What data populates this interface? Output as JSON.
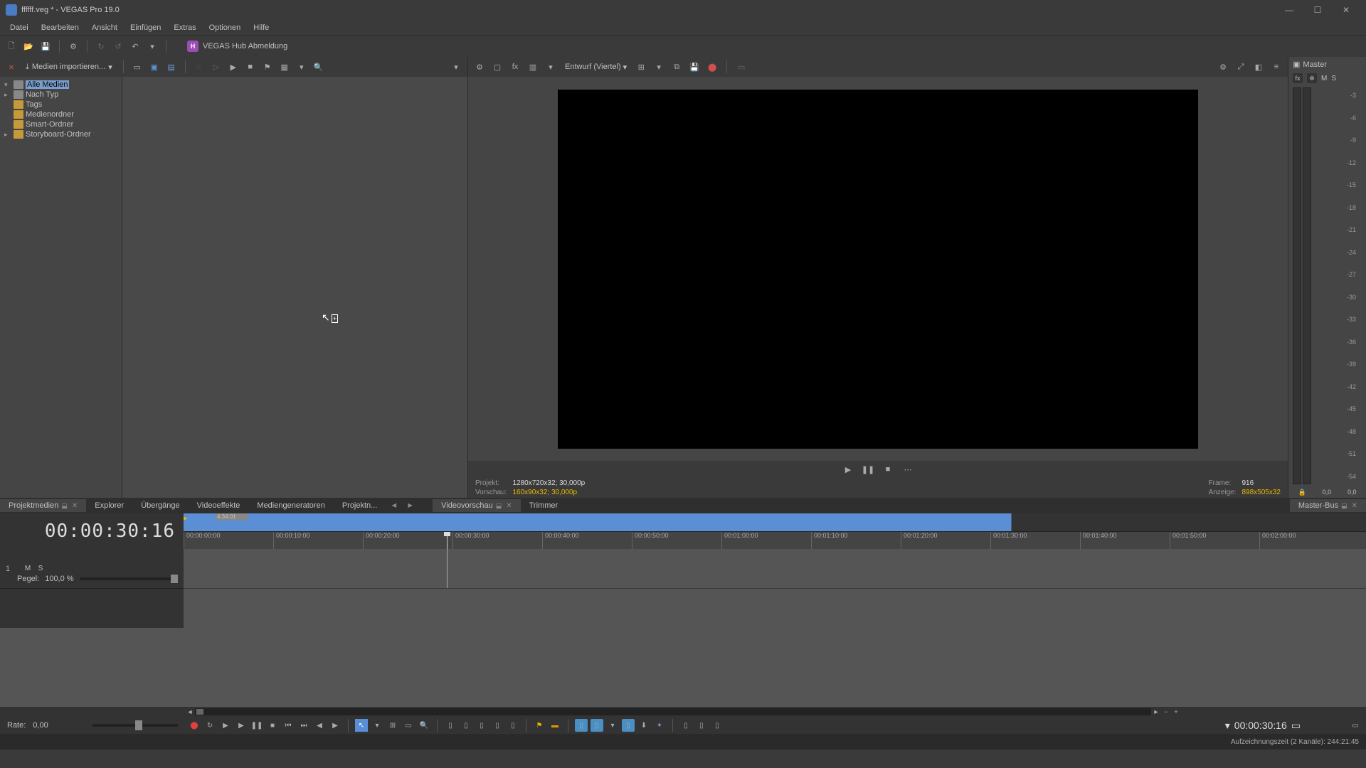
{
  "title": "ffffff.veg * - VEGAS Pro 19.0",
  "menu": [
    "Datei",
    "Bearbeiten",
    "Ansicht",
    "Einfügen",
    "Extras",
    "Optionen",
    "Hilfe"
  ],
  "hub_label": "VEGAS Hub Abmeldung",
  "import_label": "Medien importieren...",
  "tree": [
    {
      "label": "Alle Medien",
      "exp": "▾",
      "icon": "grey",
      "sel": true
    },
    {
      "label": "Nach Typ",
      "exp": "▸",
      "icon": "grey"
    },
    {
      "label": "Tags",
      "exp": "",
      "icon": "yellow"
    },
    {
      "label": "Medienordner",
      "exp": "",
      "icon": "yellow"
    },
    {
      "label": "Smart-Ordner",
      "exp": "",
      "icon": "yellow"
    },
    {
      "label": "Storyboard-Ordner",
      "exp": "▸",
      "icon": "yellow"
    }
  ],
  "preview_quality": "Entwurf (Viertel)",
  "preview_info": {
    "projekt_l": "Projekt:",
    "projekt_v": "1280x720x32; 30,000p",
    "vorschau_l": "Vorschau:",
    "vorschau_v": "160x90x32; 30,000p",
    "frame_l": "Frame:",
    "frame_v": "916",
    "anzeige_l": "Anzeige:",
    "anzeige_v": "898x505x32"
  },
  "master": {
    "title": "Master",
    "m": "M",
    "s": "S",
    "fx": "fx",
    "scale": [
      "-3",
      "-6",
      "-9",
      "-12",
      "-15",
      "-18",
      "-21",
      "-24",
      "-27",
      "-30",
      "-33",
      "-36",
      "-39",
      "-42",
      "-45",
      "-48",
      "-51",
      "-54"
    ],
    "val": "0,0"
  },
  "tabs_left": [
    {
      "label": "Projektmedien",
      "pin": true,
      "close": true,
      "active": true
    },
    {
      "label": "Explorer"
    },
    {
      "label": "Übergänge"
    },
    {
      "label": "Videoeffekte"
    },
    {
      "label": "Mediengeneratoren"
    },
    {
      "label": "Projektn..."
    }
  ],
  "tabs_right": [
    {
      "label": "Videovorschau",
      "pin": true,
      "close": true,
      "active": true
    },
    {
      "label": "Trimmer"
    }
  ],
  "master_tab": "Master-Bus",
  "timecode": "00:00:30:16",
  "selection_label": "4:34:01",
  "ruler": [
    "00:00:00:00",
    "00:00:10:00",
    "00:00:20:00",
    "00:00:30:00",
    "00:00:40:00",
    "00:00:50:00",
    "00:01:00:00",
    "00:01:10:00",
    "00:01:20:00",
    "00:01:30:00",
    "00:01:40:00",
    "00:01:50:00",
    "00:02:00:00"
  ],
  "track": {
    "num": "1",
    "pegel_l": "Pegel:",
    "pegel_v": "100,0 %",
    "m": "M",
    "s": "S"
  },
  "rate": {
    "label": "Rate:",
    "value": "0,00"
  },
  "tc2": "00:00:30:16",
  "status": "Aufzeichnungszeit (2 Kanäle): 244:21:45"
}
